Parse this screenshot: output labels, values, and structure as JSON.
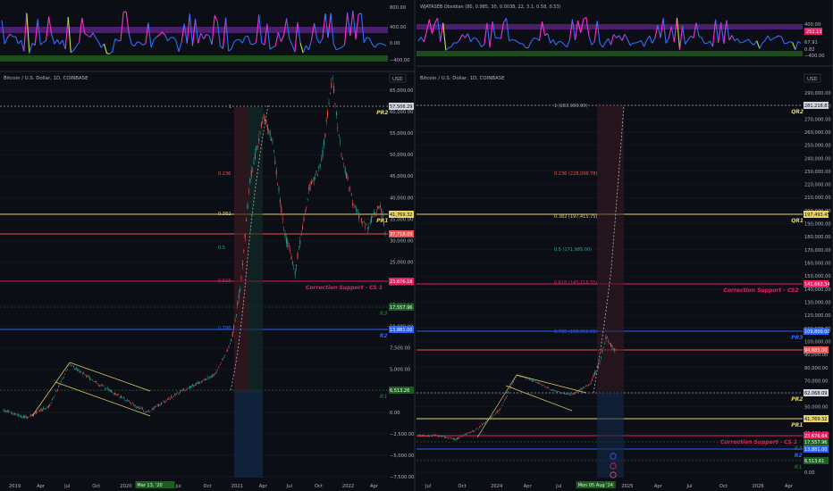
{
  "colors": {
    "bg": "#0b0e14",
    "grid": "#1c2030",
    "axis_text": "#b2b5be",
    "candle_up": "#26a69a",
    "candle_down": "#ef5350",
    "yellow_line": "#e6d36b",
    "crimson_line": "#e91e63",
    "blue_line": "#2962ff",
    "green_label": "#1b5e20",
    "osc_purple": "#4a1f6b",
    "osc_green": "#1d4d1f",
    "osc_line_pink": "#ff2ecf",
    "osc_line_blue": "#2f6dff"
  },
  "left": {
    "title": "Bitcoin / U.S. Dollar, 1D, COINBASE",
    "currency": "USD",
    "osc_ticks": [
      "800.00",
      "400.00",
      "0.00",
      "−400.00"
    ],
    "price_ticks": [
      "65,000.00",
      "60,000.00",
      "55,000.00",
      "50,000.00",
      "45,000.00",
      "40,000.00",
      "35,000.00",
      "30,000.00",
      "25,000.00",
      "20,000.00",
      "15,000.00",
      "10,000.00",
      "7,500.00",
      "5,000.00",
      "2,500.00",
      "0.00",
      "−2,500.00",
      "−5,000.00",
      "−7,500.00"
    ],
    "x_ticks": [
      "2019",
      "Apr",
      "Jul",
      "Oct",
      "2020",
      "Mar 13, '20",
      "Jul",
      "Oct",
      "2021",
      "Apr",
      "Jul",
      "Oct",
      "2022",
      "Apr"
    ],
    "levels": [
      {
        "name": "PR2",
        "tag": "57,506.29",
        "color": "#9e9e9e",
        "dash": true
      },
      {
        "name": "PR1",
        "tag": "41,769.32",
        "color": "#e6d36b",
        "dash": false
      },
      {
        "name": "",
        "tag": "37,718.09",
        "color": "#ef5350",
        "dash": false
      },
      {
        "name": "Correction Support - CS 1",
        "tag": "23,676.18",
        "color": "#e91e63",
        "dash": false
      },
      {
        "name": "R3",
        "tag": "17,557.96",
        "color": "#1b5e20",
        "dash": true
      },
      {
        "name": "R2",
        "tag": "13,881.00",
        "color": "#2962ff",
        "dash": false
      },
      {
        "name": "R1",
        "tag": "6,513.26",
        "color": "#1b5e20",
        "dash": true
      }
    ],
    "fib": [
      "0.236",
      "0.382",
      "0.5",
      "0.618",
      "0.786"
    ],
    "fib_top_label": "1",
    "date_highlight": "Mar 13, '20"
  },
  "right": {
    "title": "Bitcoin / U.S. Dollar, 1D, COINBASE",
    "indicator": "WJATASEB Obsidian (80, 0.985, 30, 0.0038, 22, 3.1, 0.58, 0.53)",
    "currency": "USD",
    "osc_ticks": [
      "400.00",
      "67.91",
      "0.82",
      "−400.00"
    ],
    "osc_badge": "252.13",
    "price_ticks": [
      "290,000.00",
      "280,000.00",
      "270,000.00",
      "260,000.00",
      "250,000.00",
      "240,000.00",
      "230,000.00",
      "220,000.00",
      "210,000.00",
      "200,000.00",
      "190,000.00",
      "180,000.00",
      "170,000.00",
      "160,000.00",
      "150,000.00",
      "140,000.00",
      "130,000.00",
      "120,000.00",
      "110,000.00",
      "100,000.00",
      "90,000.00",
      "80,000.00",
      "70,000.00",
      "60,000.00",
      "50,000.00",
      "40,000.00",
      "30,000.00",
      "20,000.00",
      "10,000.00",
      "0.00"
    ],
    "x_ticks": [
      "Jul",
      "Oct",
      "2024",
      "Apr",
      "Jul",
      "Mon 05 Aug '24",
      "2025",
      "Apr",
      "Jul",
      "Oct",
      "2026",
      "Apr"
    ],
    "levels": [
      {
        "name": "QR2",
        "tag": "281,218.87",
        "color": "#9e9e9e",
        "dash": true
      },
      {
        "name": "QR1",
        "tag": "197,493.45",
        "color": "#e6d36b",
        "dash": false
      },
      {
        "name": "Correction Support - CS2",
        "tag": "141,663.34",
        "color": "#e91e63",
        "dash": false
      },
      {
        "name": "PR3",
        "tag": "109,800.00",
        "color": "#2962ff",
        "dash": false
      },
      {
        "name": "",
        "tag": "94,685.00",
        "color": "#ef5350",
        "dash": false
      },
      {
        "name": "PR2",
        "tag": "62,068.09",
        "color": "#9e9e9e",
        "dash": true
      },
      {
        "name": "PR1",
        "tag": "41,769.32",
        "color": "#e6d36b",
        "dash": false
      },
      {
        "name": "Correction Support - CS 1",
        "tag": "23,676.64",
        "color": "#e91e63",
        "dash": false
      },
      {
        "name": "R3",
        "tag": "17,557.96",
        "color": "#1b5e20",
        "dash": true
      },
      {
        "name": "R2",
        "tag": "13,881.00",
        "color": "#2962ff",
        "dash": false
      },
      {
        "name": "R1",
        "tag": "6,513.61",
        "color": "#1b5e20",
        "dash": true
      }
    ],
    "fib": [
      "1 (283,900.00)",
      "0.236 (228,098.78)",
      "0.382 (197,415.75)",
      "0.5 (171,985.00)",
      "0.618 (145,718.55)",
      "0.786 (108,912.01)"
    ],
    "date_highlight": "Mon 05 Aug '24"
  }
}
